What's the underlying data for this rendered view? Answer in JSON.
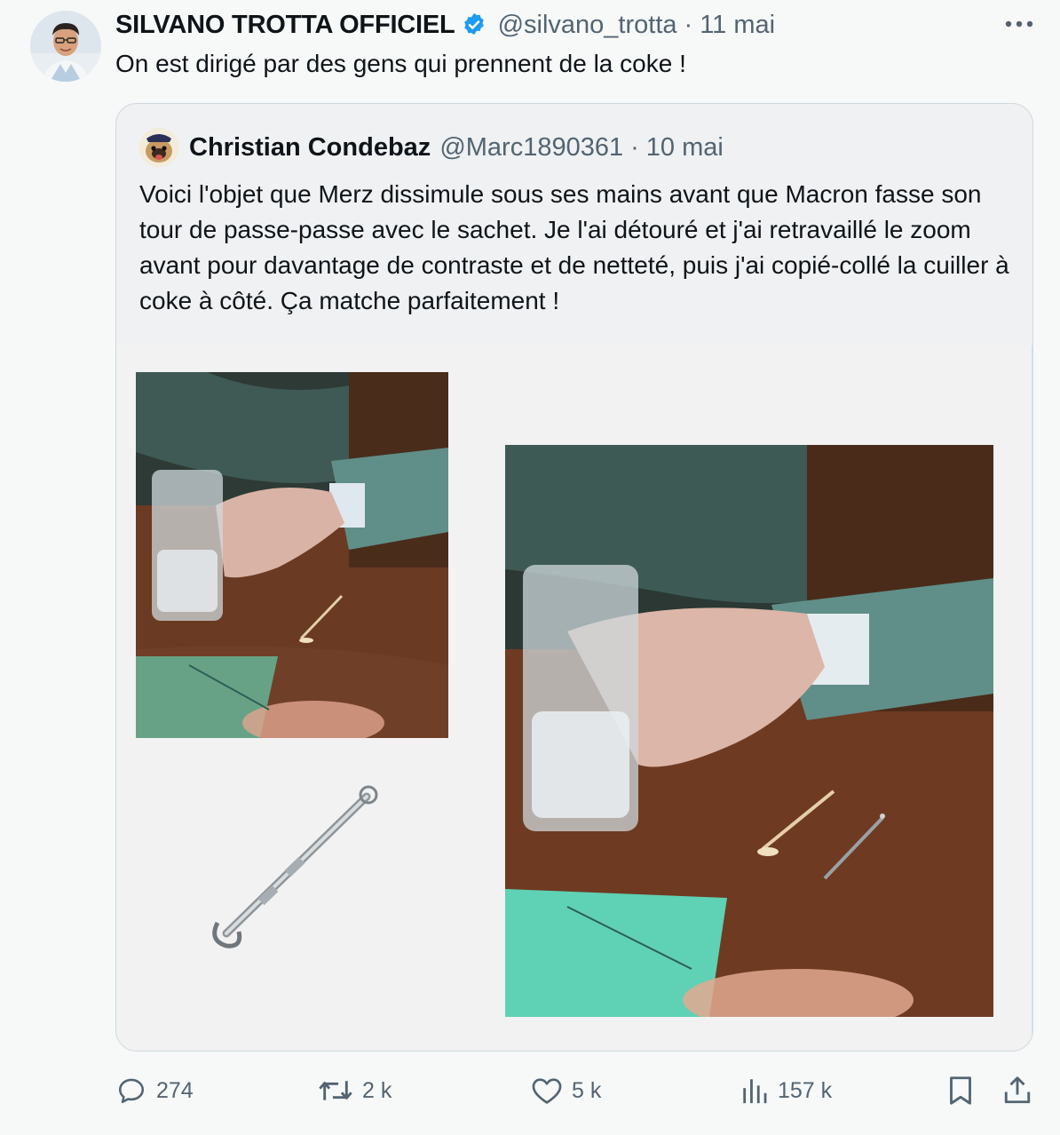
{
  "tweet": {
    "author": {
      "display_name": "SILVANO TROTTA OFFICIEL",
      "handle": "@silvano_trotta",
      "verified": true
    },
    "separator": "·",
    "date": "11 mai",
    "text": "On est dirigé par des gens qui prennent de la coke !",
    "more_icon": "more-horizontal-icon"
  },
  "quote": {
    "author": {
      "display_name": "Christian Condebaz",
      "handle": "@Marc1890361"
    },
    "separator": "·",
    "date": "10 mai",
    "text": "Voici l'objet que Merz dissimule sous ses mains avant que Macron fasse son tour de passe-passe avec le sachet. Je l'ai détouré et j'ai retravaillé le zoom avant pour davantage de contraste et de netteté, puis j'ai copié-collé la cuiller à coke à côté. Ça matche parfaitement !"
  },
  "actions": {
    "replies": "274",
    "retweets": "2 k",
    "likes": "5 k",
    "views": "157 k"
  },
  "colors": {
    "verified_blue": "#1d9bf0",
    "text_primary": "#0f1419",
    "text_secondary": "#536471",
    "border": "#cfd9de"
  }
}
